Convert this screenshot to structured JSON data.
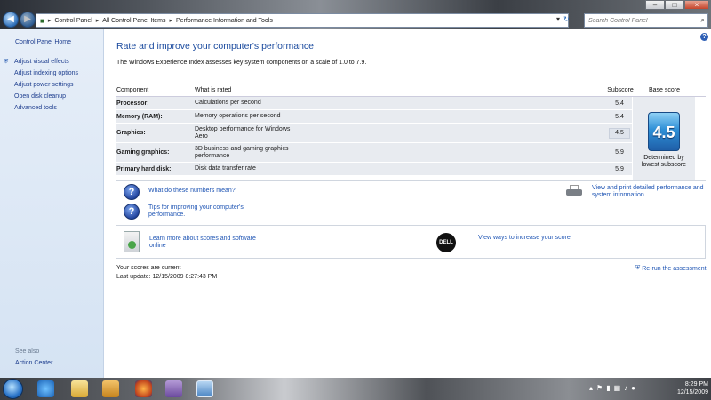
{
  "address": {
    "segments": [
      "Control Panel",
      "All Control Panel Items",
      "Performance Information and Tools"
    ],
    "search_placeholder": "Search Control Panel"
  },
  "window_controls": {
    "minimize": "–",
    "maximize": "□",
    "close": "×"
  },
  "sidebar": {
    "home": "Control Panel Home",
    "items": [
      {
        "label": "Adjust visual effects",
        "shield": true
      },
      {
        "label": "Adjust indexing options",
        "shield": false
      },
      {
        "label": "Adjust power settings",
        "shield": false
      },
      {
        "label": "Open disk cleanup",
        "shield": false
      },
      {
        "label": "Advanced tools",
        "shield": false
      }
    ],
    "see_also": "See also",
    "action_center": "Action Center"
  },
  "main": {
    "title": "Rate and improve your computer's performance",
    "intro": "The Windows Experience Index assesses key system components on a scale of 1.0 to 7.9.",
    "table": {
      "headers": {
        "component": "Component",
        "rated": "What is rated",
        "subscore": "Subscore",
        "base": "Base score"
      },
      "rows": [
        {
          "component": "Processor:",
          "rated": "Calculations per second",
          "subscore": "5.4"
        },
        {
          "component": "Memory (RAM):",
          "rated": "Memory operations per second",
          "subscore": "5.4"
        },
        {
          "component": "Graphics:",
          "rated": "Desktop performance for Windows Aero",
          "subscore": "4.5"
        },
        {
          "component": "Gaming graphics:",
          "rated": "3D business and gaming graphics performance",
          "subscore": "5.9"
        },
        {
          "component": "Primary hard disk:",
          "rated": "Disk data transfer rate",
          "subscore": "5.9"
        }
      ]
    },
    "base_score": "4.5",
    "base_caption": "Determined by lowest subscore",
    "links": {
      "what_numbers": "What do these numbers mean?",
      "tips": "Tips for improving your computer's performance.",
      "print": "View and print detailed performance and system information",
      "learn": "Learn more about scores and software online",
      "dell_ways": "View ways to increase your score",
      "dell_logo": "DELL"
    },
    "status": {
      "current": "Your scores are current",
      "last_update": "Last update: 12/15/2009 8:27:43 PM",
      "rerun": "Re-run the assessment"
    }
  },
  "taskbar": {
    "time": "8:29 PM",
    "date": "12/15/2009"
  }
}
